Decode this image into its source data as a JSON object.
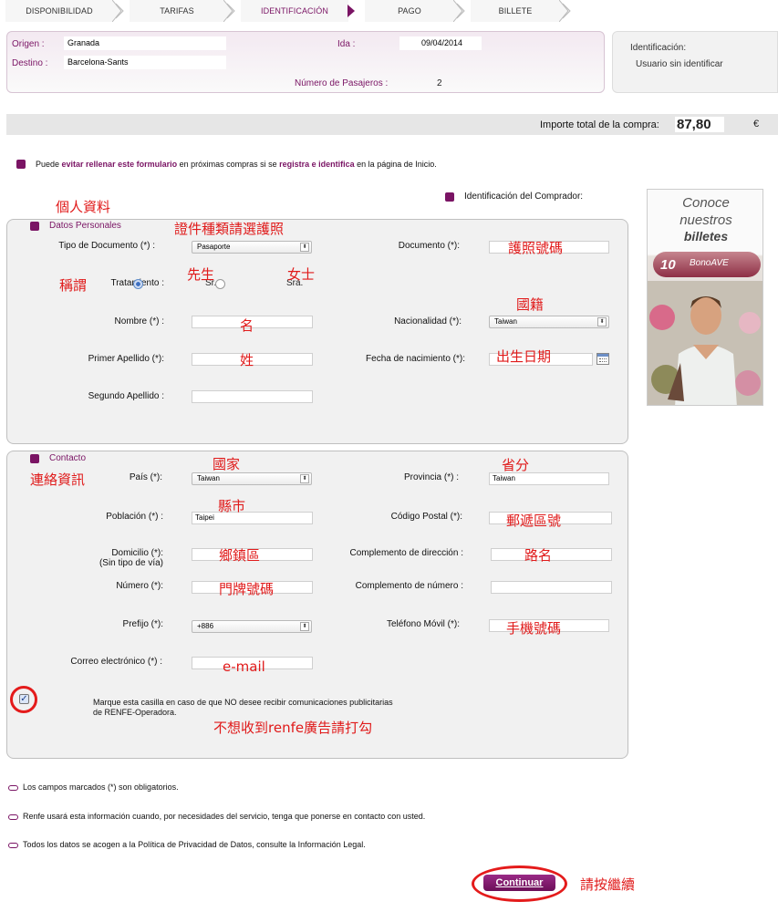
{
  "steps": [
    "DISPONIBILIDAD",
    "TARIFAS",
    "IDENTIFICACIÓN",
    "PAGO",
    "BILLETE"
  ],
  "journey": {
    "origin_label": "Origen :",
    "origin_value": "Granada",
    "destination_label": "Destino :",
    "destination_value": "Barcelona-Sants",
    "date_label": "Ida :",
    "date_value": "09/04/2014",
    "passengers_label": "Número de Pasajeros :",
    "passengers_value": "2"
  },
  "identification": {
    "title": "Identificación:",
    "status": "Usuario sin identificar"
  },
  "total": {
    "label": "Importe total de la compra:",
    "amount": "87,80",
    "currency": "€"
  },
  "notice": {
    "prefix": "Puede ",
    "bold1": "evitar rellenar este formulario",
    "middle": " en próximas compras si se ",
    "bold2": "registra e identifica",
    "suffix": " en la página de Inicio."
  },
  "buyer_heading": "Identificación del Comprador:",
  "personal": {
    "section_title": "Datos Personales",
    "doc_type_label": "Tipo de Documento (*) :",
    "doc_type_value": "Pasaporte",
    "document_label": "Documento (*):",
    "treatment_label": "Tratamiento :",
    "treatment_sr": "Sr.",
    "treatment_sra": "Sra.",
    "name_label": "Nombre (*) :",
    "nationality_label": "Nacionalidad (*):",
    "nationality_value": "Taiwan",
    "surname1_label": "Primer Apellido (*):",
    "birth_label": "Fecha de nacimiento (*):",
    "surname2_label": "Segundo Apellido :"
  },
  "contact": {
    "section_title": "Contacto",
    "country_label": "País (*):",
    "country_value": "Taiwan",
    "province_label": "Provincia (*) :",
    "province_value": "Taiwan",
    "town_label": "Población (*) :",
    "town_value": "Taipei",
    "postal_label": "Código Postal (*):",
    "address_label": "Domicilio (*):",
    "address_sub": "(Sin tipo de vía)",
    "address_extra_label": "Complemento de dirección :",
    "number_label": "Número (*):",
    "number_extra_label": "Complemento de número :",
    "prefix_label": "Prefijo (*):",
    "prefix_value": "+886",
    "mobile_label": "Teléfono Móvil (*):",
    "email_label": "Correo electrónico (*) :",
    "optout_text_line1": "Marque esta casilla en caso de que NO desee recibir comunicaciones publicitarias",
    "optout_text_line2": "de RENFE-Operadora."
  },
  "footnotes": [
    "Los campos marcados (*) son obligatorios.",
    "Renfe usará esta información cuando, por necesidades del servicio, tenga que ponerse en contacto con usted.",
    "Todos los datos se acogen a la Política de Privacidad de Datos, consulte la Información Legal."
  ],
  "continue_label": "Continuar",
  "ad": {
    "line1": "Conoce",
    "line2": "nuestros",
    "line3": "billetes",
    "brand": "BonoAVE",
    "badge": "10"
  },
  "annotations": {
    "personal_info": "個人資料",
    "doc_type_hint": "證件種類請選護照",
    "passport_no": "護照號碼",
    "title": "稱謂",
    "mr": "先生",
    "ms": "女士",
    "nationality": "國籍",
    "first_name": "名",
    "last_name": "姓",
    "birth_date": "出生日期",
    "contact_info": "連絡資訊",
    "country": "國家",
    "province": "省分",
    "city": "縣市",
    "postal": "郵遞區號",
    "district": "鄉鎮區",
    "road": "路名",
    "house_no": "門牌號碼",
    "mobile": "手機號碼",
    "email": "e-mail",
    "no_ads": "不想收到renfe廣告請打勾",
    "press_continue": "請按繼續"
  },
  "colors": {
    "brand": "#7a1464",
    "annotation": "#e01a1a",
    "panel": "#f1f1f1"
  }
}
